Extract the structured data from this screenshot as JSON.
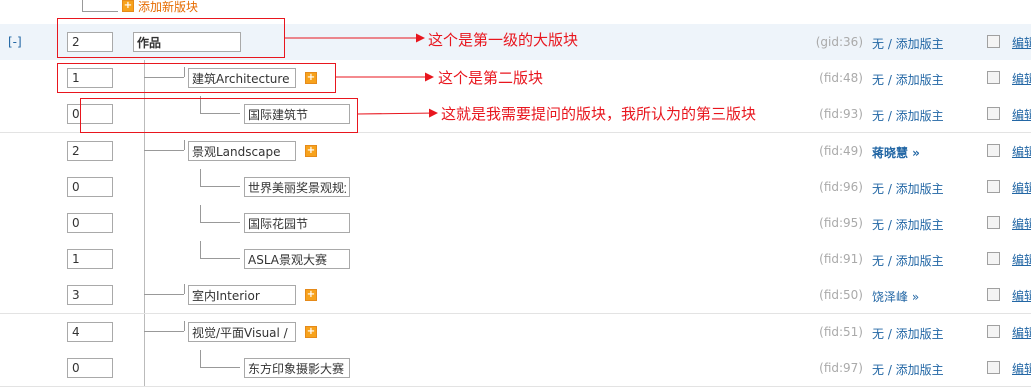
{
  "top": {
    "add_board_label": "添加新版块"
  },
  "rows": [
    {
      "level": 1,
      "toggle": "[-]",
      "order": "2",
      "name": "作品",
      "id_label": "(gid:36)",
      "moderator": "无 / 添加版主",
      "mod_bold": false,
      "has_add": false,
      "edit": "编辑"
    },
    {
      "level": 2,
      "order": "1",
      "name": "建筑Architecture",
      "id_label": "(fid:48)",
      "moderator": "无 / 添加版主",
      "mod_bold": false,
      "has_add": true,
      "edit": "编辑"
    },
    {
      "level": 3,
      "order": "0",
      "name": "国际建筑节",
      "id_label": "(fid:93)",
      "moderator": "无 / 添加版主",
      "mod_bold": false,
      "has_add": false,
      "edit": "编辑"
    },
    {
      "level": 2,
      "order": "2",
      "name": "景观Landscape",
      "id_label": "(fid:49)",
      "moderator": "蒋晓慧 »",
      "mod_bold": true,
      "has_add": true,
      "edit": "编辑"
    },
    {
      "level": 3,
      "order": "0",
      "name": "世界美丽奖景观规划",
      "id_label": "(fid:96)",
      "moderator": "无 / 添加版主",
      "mod_bold": false,
      "has_add": false,
      "edit": "编辑"
    },
    {
      "level": 3,
      "order": "0",
      "name": "国际花园节",
      "id_label": "(fid:95)",
      "moderator": "无 / 添加版主",
      "mod_bold": false,
      "has_add": false,
      "edit": "编辑"
    },
    {
      "level": 3,
      "order": "1",
      "name": "ASLA景观大赛",
      "id_label": "(fid:91)",
      "moderator": "无 / 添加版主",
      "mod_bold": false,
      "has_add": false,
      "edit": "编辑"
    },
    {
      "level": 2,
      "order": "3",
      "name": "室内Interior",
      "id_label": "(fid:50)",
      "moderator": "饶泽峰 »",
      "mod_bold": false,
      "has_add": true,
      "edit": "编辑"
    },
    {
      "level": 2,
      "order": "4",
      "name": "视觉/平面Visual / Graphic",
      "id_label": "(fid:51)",
      "moderator": "无 / 添加版主",
      "mod_bold": false,
      "has_add": true,
      "edit": "编辑"
    },
    {
      "level": 3,
      "order": "0",
      "name": "东方印象摄影大赛",
      "id_label": "(fid:97)",
      "moderator": "无 / 添加版主",
      "mod_bold": false,
      "has_add": false,
      "edit": "编辑"
    }
  ],
  "annotations": [
    {
      "text": "这个是第一级的大版块"
    },
    {
      "text": "这个是第二版块"
    },
    {
      "text": "这就是我需要提问的版块，我所认为的第三版块"
    }
  ],
  "colors": {
    "annotation": "#e8161e",
    "link": "#2367a5",
    "add_link": "#e66b00",
    "level1_bg": "#eef4fa"
  }
}
